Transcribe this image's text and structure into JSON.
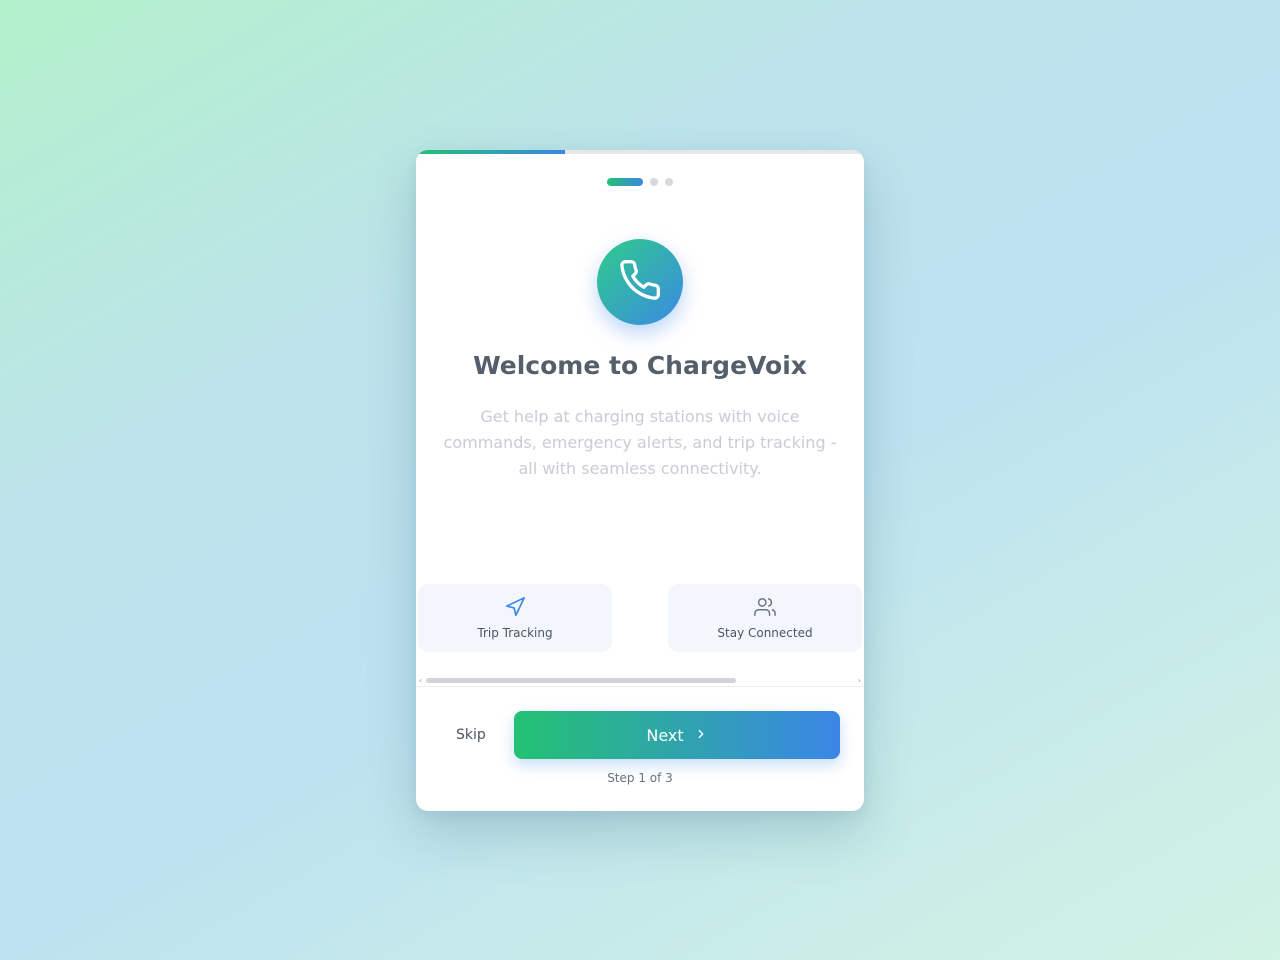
{
  "onboarding": {
    "progress_fraction": 0.333,
    "current_step_index": 0,
    "total_steps": 3,
    "hero_icon": "phone-icon",
    "title": "Welcome to ChargeVoix",
    "description": "Get help at charging stations with voice commands, emergency alerts, and trip tracking - all with seamless connectivity.",
    "features": [
      {
        "icon": "navigation-arrow-icon",
        "label": "Trip Tracking",
        "icon_color": "#3b86e6"
      },
      {
        "icon": "users-icon",
        "label": "Stay Connected",
        "icon_color": "#6b7280"
      }
    ],
    "skip_label": "Skip",
    "next_label": "Next",
    "next_icon": "chevron-right-icon",
    "step_text": "Step 1 of 3"
  },
  "colors": {
    "accent_green": "#22c172",
    "accent_blue": "#3b86e6",
    "title": "#555f6b",
    "description": "#c9ccd6",
    "feature_background": "#f4f6fd"
  }
}
